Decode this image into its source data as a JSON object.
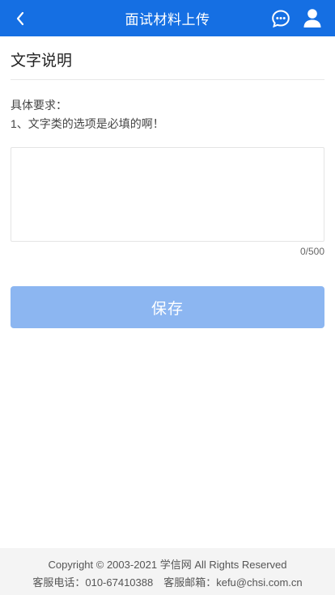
{
  "header": {
    "title": "面试材料上传",
    "back_icon": "chevron-left-icon",
    "message_icon": "chat-bubble-icon",
    "user_icon": "user-icon",
    "background_color": "#156fe3"
  },
  "main": {
    "section_title": "文字说明",
    "requirement_label": "具体要求：",
    "requirement_line": "1、文字类的选项是必填的啊！",
    "textarea": {
      "value": "",
      "placeholder": ""
    },
    "counter": "0/500",
    "save_label": "保存",
    "save_color": "#8cb6f1"
  },
  "footer": {
    "copyright": "Copyright © 2003-2021 学信网 All Rights Reserved",
    "contact": "客服电话：010-67410388　客服邮箱：kefu@chsi.com.cn"
  }
}
